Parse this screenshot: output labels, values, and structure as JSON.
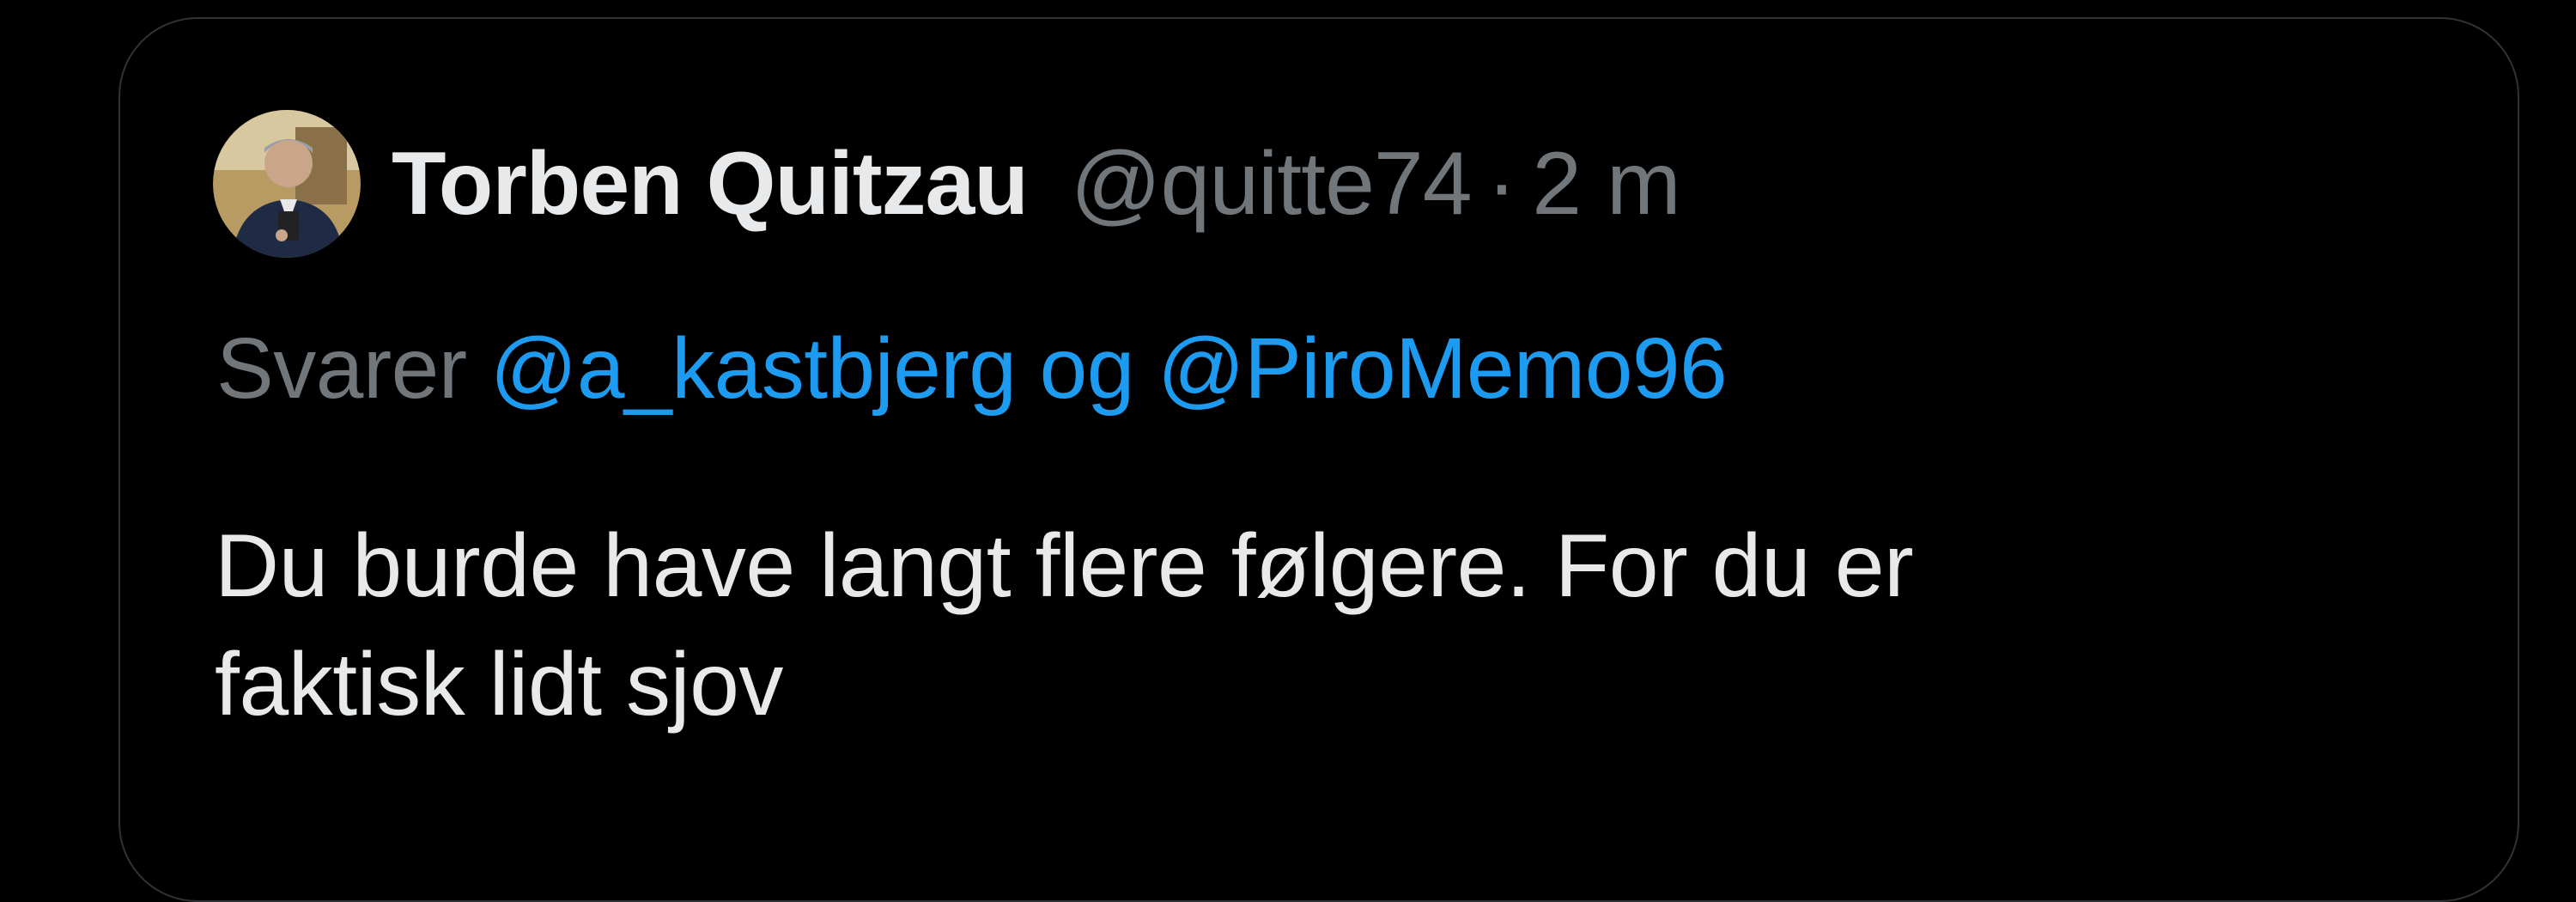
{
  "tweet": {
    "author": {
      "name": "Torben Quitzau",
      "handle": "@quitte74",
      "avatar_icon": "profile-photo"
    },
    "separator": "·",
    "time": "2 m",
    "reply": {
      "prefix": "Svarer",
      "mention_1": "@a_kastbjerg",
      "conjunction": "og",
      "mention_2": "@PiroMemo96"
    },
    "text_lines": [
      "Du burde have langt flere følgere. For du er",
      "faktisk lidt sjov"
    ]
  },
  "colors": {
    "background": "#000000",
    "primary_text": "#e7e9ea",
    "secondary_text": "#71767b",
    "link": "#1d9bf0",
    "border": "#2f3336"
  }
}
